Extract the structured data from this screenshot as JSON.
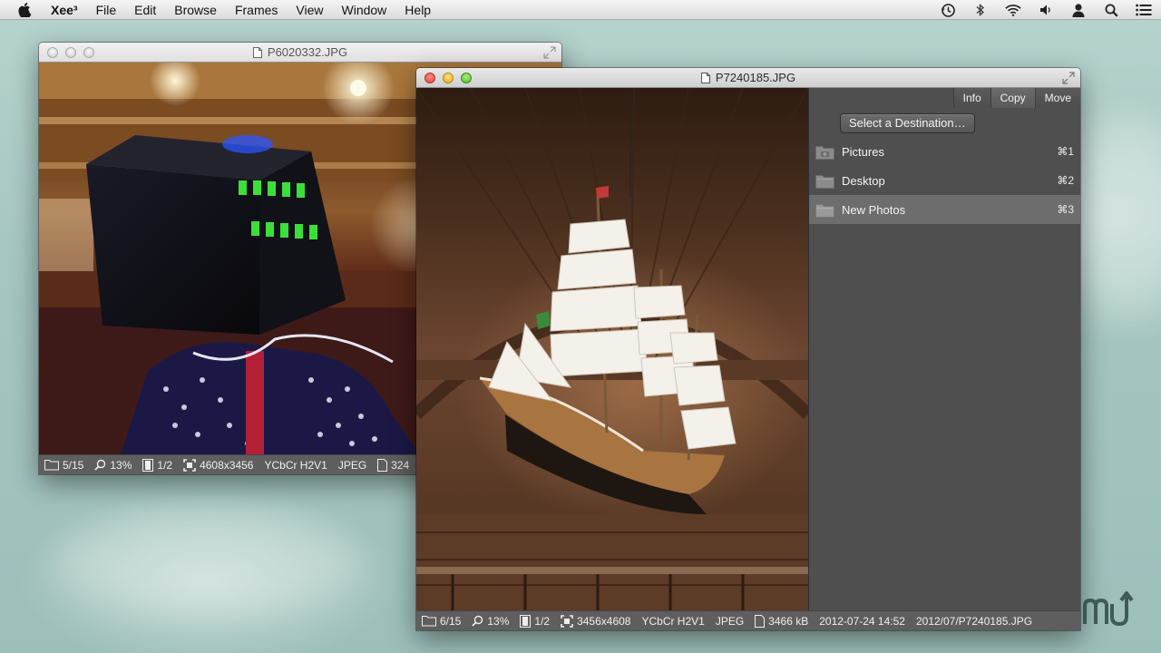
{
  "menubar": {
    "app_name": "Xee³",
    "items": [
      "File",
      "Edit",
      "Browse",
      "Frames",
      "View",
      "Window",
      "Help"
    ],
    "status_icons": [
      "time-machine-icon",
      "bluetooth-icon",
      "wifi-icon",
      "volume-icon",
      "user-icon",
      "spotlight-icon",
      "notification-center-icon"
    ]
  },
  "window_back": {
    "title": "P6020332.JPG",
    "status": {
      "position": "5/15",
      "zoom": "13%",
      "frames": "1/2",
      "dimensions": "4608x3456",
      "color": "YCbCr H2V1",
      "format": "JPEG",
      "size": "324"
    }
  },
  "window_front": {
    "title": "P7240185.JPG",
    "tabs": [
      "Info",
      "Copy",
      "Move"
    ],
    "active_tab": "Copy",
    "select_destination": "Select a Destination…",
    "destinations": [
      {
        "label": "Pictures",
        "shortcut": "⌘1",
        "icon": "camera-folder-icon"
      },
      {
        "label": "Desktop",
        "shortcut": "⌘2",
        "icon": "folder-icon"
      },
      {
        "label": "New Photos",
        "shortcut": "⌘3",
        "icon": "folder-icon"
      }
    ],
    "selected_destination": "New Photos",
    "status": {
      "position": "6/15",
      "zoom": "13%",
      "frames": "1/2",
      "dimensions": "3456x4608",
      "color": "YCbCr H2V1",
      "format": "JPEG",
      "size": "3466 kB",
      "date": "2012-07-24 14:52",
      "path": "2012/07/P7240185.JPG"
    }
  },
  "colors": {
    "panel_bg": "#4f4f4f",
    "statusbar_bg": "#5e5e5e",
    "selected_row": "#6d6d6d",
    "desktop": "#a6c6c1"
  }
}
